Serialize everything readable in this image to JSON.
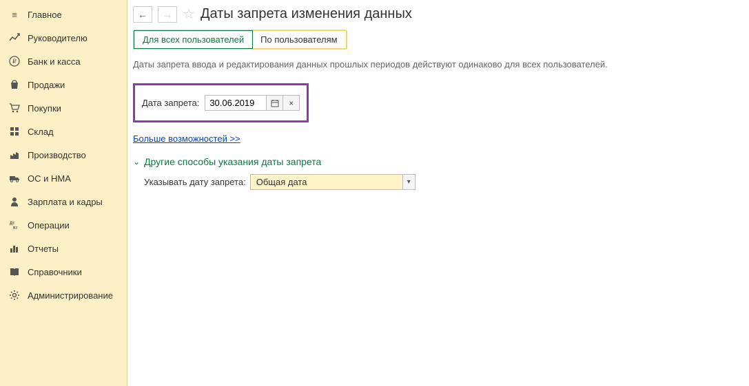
{
  "sidebar": {
    "items": [
      {
        "label": "Главное"
      },
      {
        "label": "Руководителю"
      },
      {
        "label": "Банк и касса"
      },
      {
        "label": "Продажи"
      },
      {
        "label": "Покупки"
      },
      {
        "label": "Склад"
      },
      {
        "label": "Производство"
      },
      {
        "label": "ОС и НМА"
      },
      {
        "label": "Зарплата и кадры"
      },
      {
        "label": "Операции"
      },
      {
        "label": "Отчеты"
      },
      {
        "label": "Справочники"
      },
      {
        "label": "Администрирование"
      }
    ]
  },
  "header": {
    "title": "Даты запрета изменения данных"
  },
  "tabs": {
    "all_users": "Для всех пользователей",
    "by_users": "По пользователям"
  },
  "description": "Даты запрета ввода и редактирования данных прошлых периодов действуют одинаково для всех пользователей.",
  "date_block": {
    "label": "Дата запрета:",
    "value": "30.06.2019"
  },
  "more_link": "Больше возможностей >>",
  "section": {
    "title": "Другие способы указания даты запрета"
  },
  "specify": {
    "label": "Указывать дату запрета:",
    "value": "Общая дата"
  }
}
